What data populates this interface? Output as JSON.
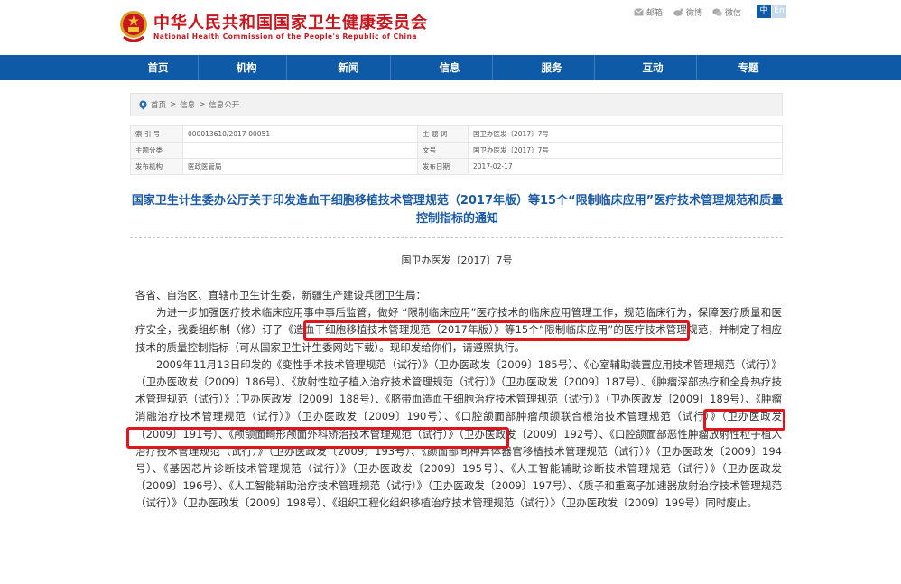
{
  "header": {
    "site_title_cn": "中华人民共和国国家卫生健康委员会",
    "site_title_en": "National Health Commission of the People's Republic of China",
    "share": [
      {
        "label": "邮箱",
        "icon": "mail-icon"
      },
      {
        "label": "微博",
        "icon": "weibo-icon"
      },
      {
        "label": "微信",
        "icon": "wechat-icon"
      }
    ],
    "lang_zh": "中",
    "lang_en": "En"
  },
  "nav": [
    "首页",
    "机构",
    "新闻",
    "信息",
    "服务",
    "互动",
    "专题"
  ],
  "breadcrumb": [
    "首页",
    ">",
    "信息",
    ">",
    "信息公开"
  ],
  "meta": {
    "index_label": "索 引 号",
    "index_value": "000013610/2017-00051",
    "subject_label": "主 题 词",
    "subject_value": "国卫办医发〔2017〕7号",
    "category_label": "主题分类",
    "category_value": "",
    "docno_label": "文号",
    "docno_value": "国卫办医发〔2017〕7号",
    "issuer_label": "发布机构",
    "issuer_value": "医政医管局",
    "date_label": "发布日期",
    "date_value": "2017-02-17"
  },
  "article": {
    "title": "国家卫生计生委办公厅关于印发造血干细胞移植技术管理规范（2017年版）等15个“限制临床应用”医疗技术管理规范和质量控制指标的通知",
    "doc_number": "国卫办医发〔2017〕7号",
    "salutation": "各省、自治区、直辖市卫生计生委，新疆生产建设兵团卫生局：",
    "para1": "为进一步加强医疗技术临床应用事中事后监管，做好 “限制临床应用”医疗技术的临床应用管理工作，规范临床行为，保障医疗质量和医疗安全，我委组织制（修）订了《造血干细胞移植技术管理规范（2017年版）》等15个“限制临床应用”的医疗技术管理规范，并制定了相应技术的质量控制指标（可从国家卫生计生委网站下载）。现印发给你们，请遵照执行。",
    "para2": "2009年11月13日印发的《变性手术技术管理规范（试行）》（卫办医政发〔2009〕185号）、《心室辅助装置应用技术管理规范（试行）》（卫办医政发〔2009〕186号）、《放射性粒子植入治疗技术管理规范（试行）》（卫办医政发〔2009〕187号）、《肿瘤深部热疗和全身热疗技术管理规范（试行）》（卫办医政发〔2009〕188号）、《脐带血造血干细胞治疗技术管理规范（试行）》（卫办医政发〔2009〕189号）、《肿瘤消融治疗技术管理规范（试行）》（卫办医政发〔2009〕190号）、《口腔颌面部肿瘤颅颌联合根治技术管理规范（试行）》（卫办医政发〔2009〕191号）、《颅颌面畸形颅面外科矫治技术管理规范（试行）》（卫办医政发〔2009〕192号）、《口腔颌面部恶性肿瘤放射性粒子植入治疗技术管理规范（试行）》（卫办医政发〔2009〕193号）、《颜面部同种异体器官移植技术管理规范（试行）》（卫办医政发〔2009〕194号）、《基因芯片诊断技术管理规范（试行）》（卫办医政发〔2009〕195号）、《人工智能辅助诊断技术管理规范（试行）》（卫办医政发〔2009〕196号）、《人工智能辅助治疗技术管理规范（试行）》（卫办医政发〔2009〕197号）、《质子和重离子加速器放射治疗技术管理规范（试行）》（卫办医政发〔2009〕198号）、《组织工程化组织移植治疗技术管理规范（试行）》（卫办医政发〔2009〕199号）同时废止。"
  },
  "colors": {
    "brand_red": "#c8161e",
    "nav_blue": "#0e5aa7",
    "title_blue": "#1b5aa5",
    "highlight_red": "#e0161e"
  }
}
